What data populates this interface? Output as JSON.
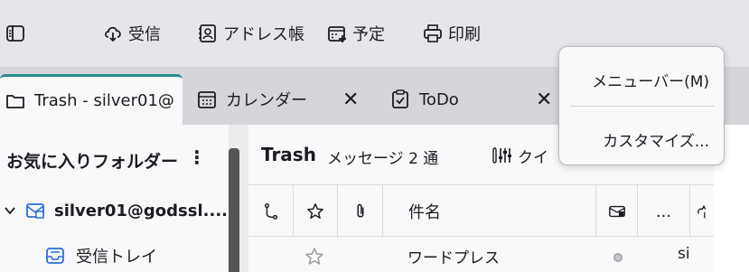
{
  "toolbar": {
    "get_messages": "受信",
    "address_book": "アドレス帳",
    "calendar": "予定",
    "print": "印刷"
  },
  "tabs": [
    {
      "label": "Trash - silver01@",
      "icon": "folder-icon"
    },
    {
      "label": "カレンダー",
      "icon": "calendar-icon"
    },
    {
      "label": "ToDo",
      "icon": "task-icon"
    }
  ],
  "close_glyph": "✕",
  "folder_pane": {
    "title": "お気に入りフォルダー",
    "more_glyph": "⋮",
    "account": "silver01@godssl....",
    "inbox": "受信トレイ"
  },
  "message_list": {
    "folder_name": "Trash",
    "count": "メッセージ 2 通",
    "quick_filter": "クイ",
    "columns": {
      "subject": "件名",
      "more": "..."
    },
    "rows": [
      {
        "subject": "ワードプレス",
        "correspondent": "si"
      }
    ]
  },
  "context_menu": {
    "menubar": "メニューバー(M)",
    "customize": "カスタマイズ..."
  },
  "colors": {
    "accent": "#2a8c8c",
    "account_icon": "#2a6fdb"
  }
}
